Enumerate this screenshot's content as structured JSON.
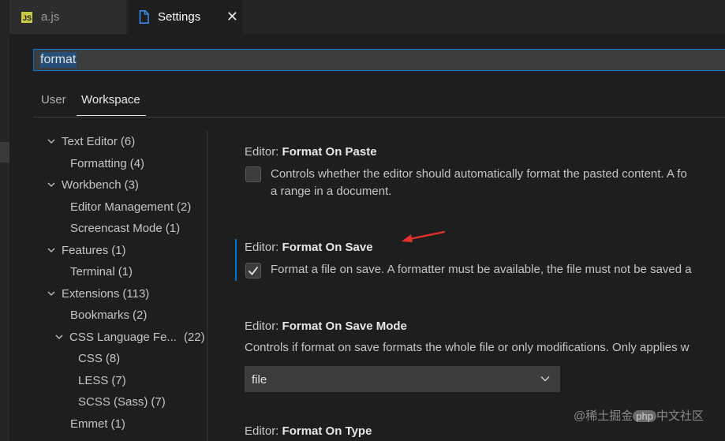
{
  "tabs": [
    {
      "label": "a.js",
      "icon": "js-file-icon",
      "badge": "JS"
    },
    {
      "label": "Settings",
      "icon": "file-icon",
      "close": "✕"
    }
  ],
  "search": {
    "value": "format"
  },
  "scopes": {
    "user": "User",
    "workspace": "Workspace"
  },
  "toc": [
    {
      "label": "Text Editor",
      "count": "(6)",
      "expanded": true
    },
    {
      "label": "Formatting",
      "count": "(4)"
    },
    {
      "label": "Workbench",
      "count": "(3)",
      "expanded": true
    },
    {
      "label": "Editor Management",
      "count": "(2)"
    },
    {
      "label": "Screencast Mode",
      "count": "(1)"
    },
    {
      "label": "Features",
      "count": "(1)",
      "expanded": true
    },
    {
      "label": "Terminal",
      "count": "(1)"
    },
    {
      "label": "Extensions",
      "count": "(113)",
      "expanded": true
    },
    {
      "label": "Bookmarks",
      "count": "(2)"
    },
    {
      "label": "CSS Language Fe...",
      "count": "(22)",
      "expanded": true
    },
    {
      "label": "CSS",
      "count": "(8)"
    },
    {
      "label": "LESS",
      "count": "(7)"
    },
    {
      "label": "SCSS (Sass)",
      "count": "(7)"
    },
    {
      "label": "Emmet",
      "count": "(1)"
    }
  ],
  "settings": {
    "paste": {
      "category": "Editor: ",
      "name": "Format On Paste",
      "desc1": "Controls whether the editor should automatically format the pasted content. A fo",
      "desc2": "a range in a document.",
      "checked": false
    },
    "save": {
      "category": "Editor: ",
      "name": "Format On Save",
      "desc": "Format a file on save. A formatter must be available, the file must not be saved a",
      "checked": true
    },
    "saveMode": {
      "category": "Editor: ",
      "name": "Format On Save Mode",
      "desc": "Controls if format on save formats the whole file or only modifications. Only applies w",
      "value": "file"
    },
    "type": {
      "category": "Editor: ",
      "name": "Format On Type"
    }
  },
  "watermark": {
    "prefix": "@稀土掘金",
    "badge": "php",
    "suffix": "中文社区"
  },
  "colors": {
    "accent": "#007acc",
    "annotation": "#e8302c",
    "jsBadge": "#cbcb41"
  }
}
